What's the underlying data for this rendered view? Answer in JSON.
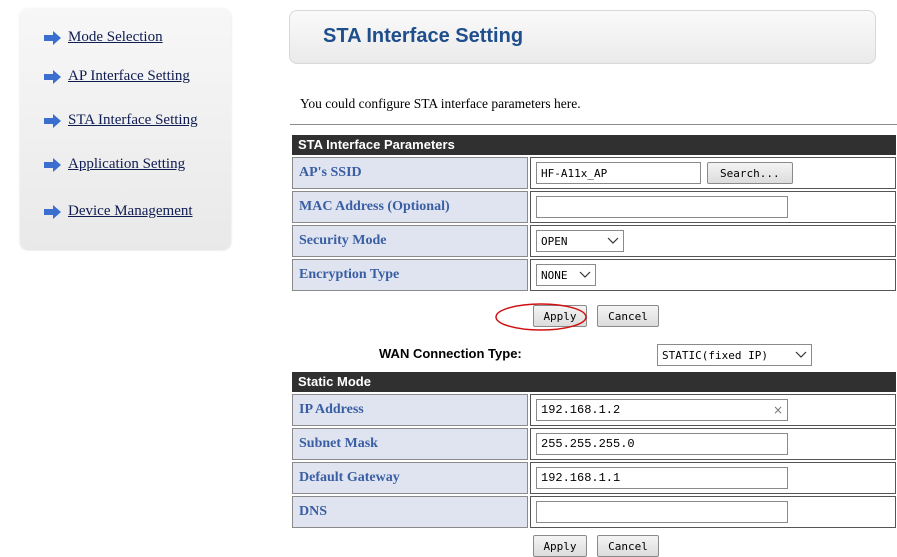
{
  "sidebar": {
    "items": [
      {
        "label": "Mode Selection"
      },
      {
        "label": "AP Interface Setting"
      },
      {
        "label": "STA Interface Setting"
      },
      {
        "label": "Application Setting"
      },
      {
        "label": "Device Management"
      }
    ]
  },
  "header": {
    "title": "STA Interface Setting"
  },
  "intro": "You could configure STA interface parameters here.",
  "sta_params": {
    "heading": "STA Interface Parameters",
    "ssid_label": "AP's SSID",
    "ssid_value": "HF-A11x_AP",
    "search_label": "Search...",
    "mac_label": "MAC Address (Optional)",
    "mac_value": "",
    "security_label": "Security Mode",
    "security_value": "OPEN",
    "encryption_label": "Encryption Type",
    "encryption_value": "NONE",
    "apply_label": "Apply",
    "cancel_label": "Cancel"
  },
  "wan": {
    "label": "WAN Connection Type:",
    "value": "STATIC(fixed IP)"
  },
  "static_mode": {
    "heading": "Static Mode",
    "ip_label": "IP Address",
    "ip_value": "192.168.1.2",
    "clear_symbol": "×",
    "subnet_label": "Subnet Mask",
    "subnet_value": "255.255.255.0",
    "gateway_label": "Default Gateway",
    "gateway_value": "192.168.1.1",
    "dns_label": "DNS",
    "dns_value": "",
    "apply_label": "Apply",
    "cancel_label": "Cancel"
  },
  "colors": {
    "link": "#0f1c50",
    "title": "#1f4e8c",
    "label_text": "#3a5ea3",
    "label_bg": "#dfe4f0",
    "section_head": "#303030",
    "arrow": "#3a6fd0",
    "annotation": "#d01010"
  },
  "icons": {
    "nav_arrow": "arrow-right-icon",
    "dropdown": "chevron-down-icon",
    "clear": "clear-icon"
  }
}
